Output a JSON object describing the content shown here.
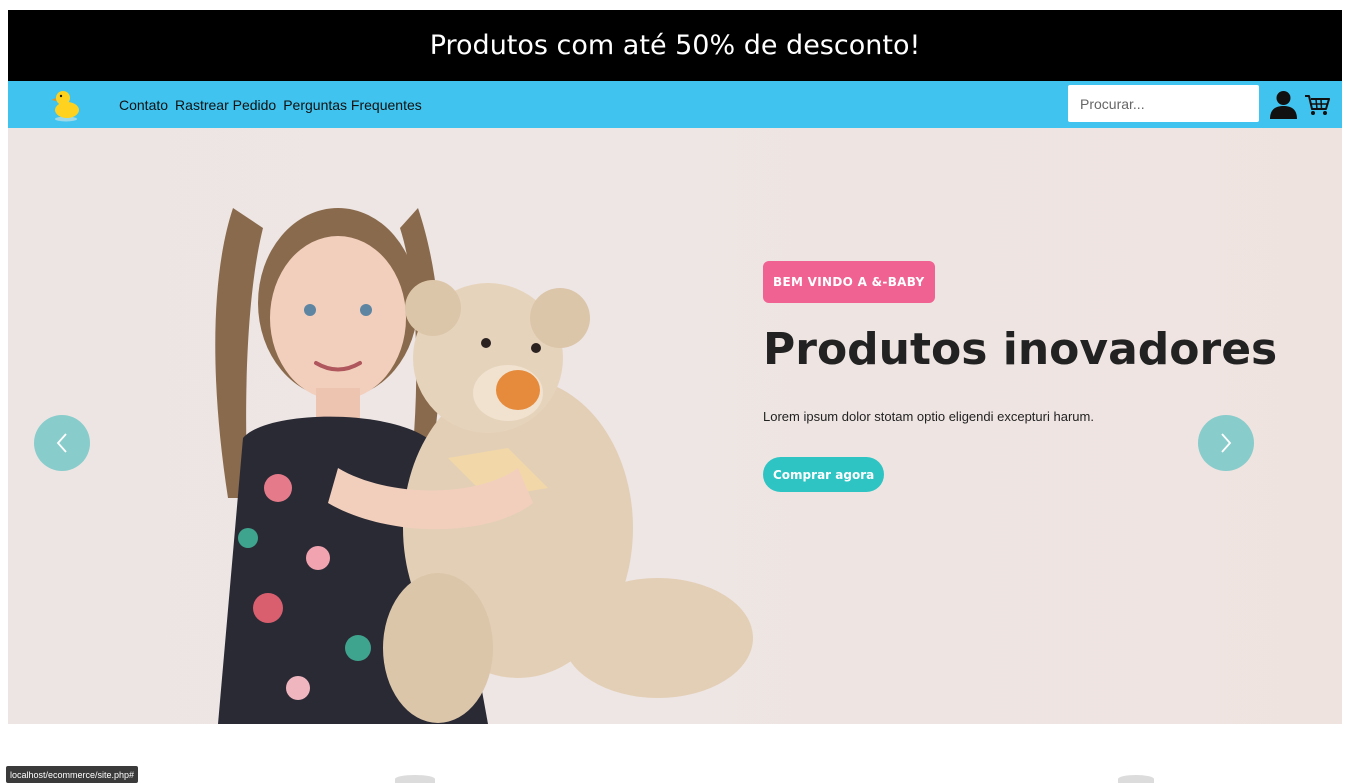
{
  "promo": {
    "text": "Produtos com até 50% de desconto!"
  },
  "navbar": {
    "links": [
      "Contato",
      "Rastrear Pedido",
      "Perguntas Frequentes"
    ],
    "search_placeholder": "Procurar...",
    "icons": {
      "logo": "duck-logo-icon",
      "user": "user-icon",
      "cart": "cart-icon"
    }
  },
  "hero": {
    "badge": "BEM VINDO A &-BABY",
    "title": "Produtos inovadores",
    "subtitle": "Lorem ipsum dolor stotam optio eligendi excepturi harum.",
    "cta": "Comprar agora"
  },
  "status_bar": {
    "url": "localhost/ecommerce/site.php#"
  },
  "colors": {
    "promo_bg": "#000000",
    "nav_bg": "#40c4ef",
    "badge": "#f06292",
    "cta": "#2ec4c4",
    "arrow": "#65c4c4"
  }
}
